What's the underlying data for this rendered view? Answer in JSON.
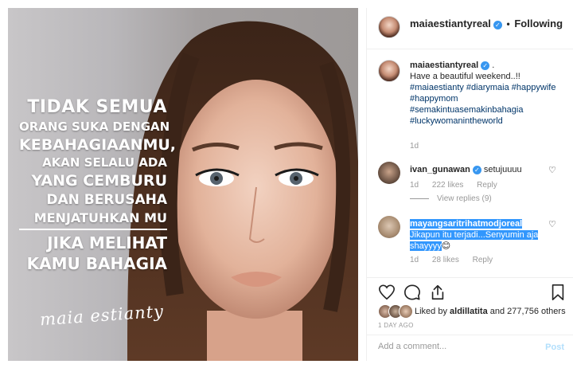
{
  "photo": {
    "quote_lines": [
      "TIDAK SEMUA",
      "ORANG SUKA DENGAN",
      "KEBAHAGIAANMU,",
      "AKAN SELALU ADA",
      "YANG CEMBURU",
      "DAN BERUSAHA",
      "MENJATUHKAN MU",
      "JIKA MELIHAT",
      "KAMU BAHAGIA"
    ],
    "signature": "maia estianty"
  },
  "header": {
    "username": "maiaestiantyreal",
    "separator": "•",
    "follow_status": "Following",
    "verified_icon": "verified-badge-icon"
  },
  "caption": {
    "username": "maiaestiantyreal",
    "text_lines": [
      "Have a beautiful weekend..!!",
      "#maiaestianty #diarymaia #happywife",
      "#happymom",
      "#semakintuasemakinbahagia",
      "#luckywomanintheworld"
    ],
    "age": "1d"
  },
  "comments": [
    {
      "username": "ivan_gunawan",
      "text": "setujuuuu",
      "age": "1d",
      "likes": "222 likes",
      "reply": "Reply"
    },
    {
      "username": "mayangsaritrihatmodjoreal",
      "text_lines": [
        "Jikapun itu terjadi...Senyumin aja",
        "shayyyy"
      ],
      "emoji": "😊",
      "age": "1d",
      "likes": "28 likes",
      "reply": "Reply"
    }
  ],
  "view_replies": "View replies (9)",
  "actions": {
    "icons": [
      "heart-icon",
      "comment-icon",
      "share-icon",
      "bookmark-icon"
    ]
  },
  "liked_by": {
    "prefix": "Liked by ",
    "user": "aldillatita",
    "suffix": " and 277,756 others"
  },
  "timestamp": "1 DAY AGO",
  "add_comment": {
    "placeholder": "Add a comment...",
    "post_label": "Post"
  },
  "colors": {
    "accent_blue": "#3897f0",
    "selection_blue": "#3297fd",
    "hashtag": "#003569",
    "muted_text": "#999999",
    "post_disabled": "#b2dffc"
  }
}
